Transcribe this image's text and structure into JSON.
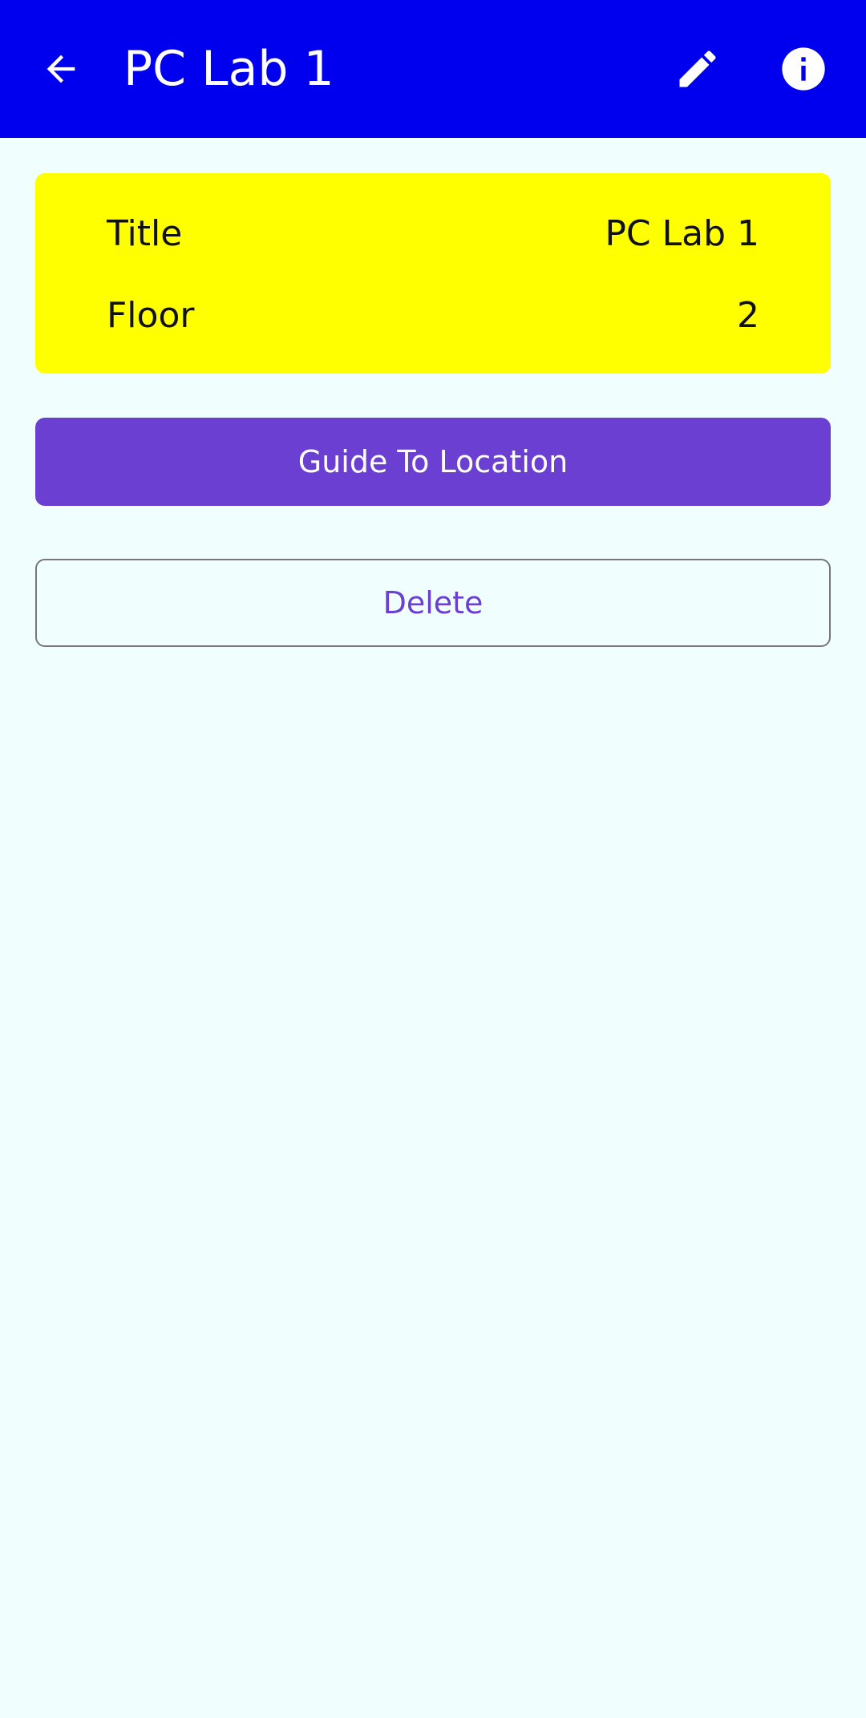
{
  "app_bar": {
    "title": "PC Lab 1",
    "back_icon": "arrow-left-icon",
    "edit_icon": "pencil-icon",
    "info_icon": "info-icon",
    "background": "#0000EE"
  },
  "details": {
    "background": "#FFFF00",
    "rows": [
      {
        "label": "Title",
        "value": "PC Lab 1"
      },
      {
        "label": "Floor",
        "value": "2"
      }
    ]
  },
  "actions": {
    "guide_label": "Guide To Location",
    "guide_color": "#6A3FD2",
    "delete_label": "Delete"
  },
  "page_background": "#F0FFFE"
}
